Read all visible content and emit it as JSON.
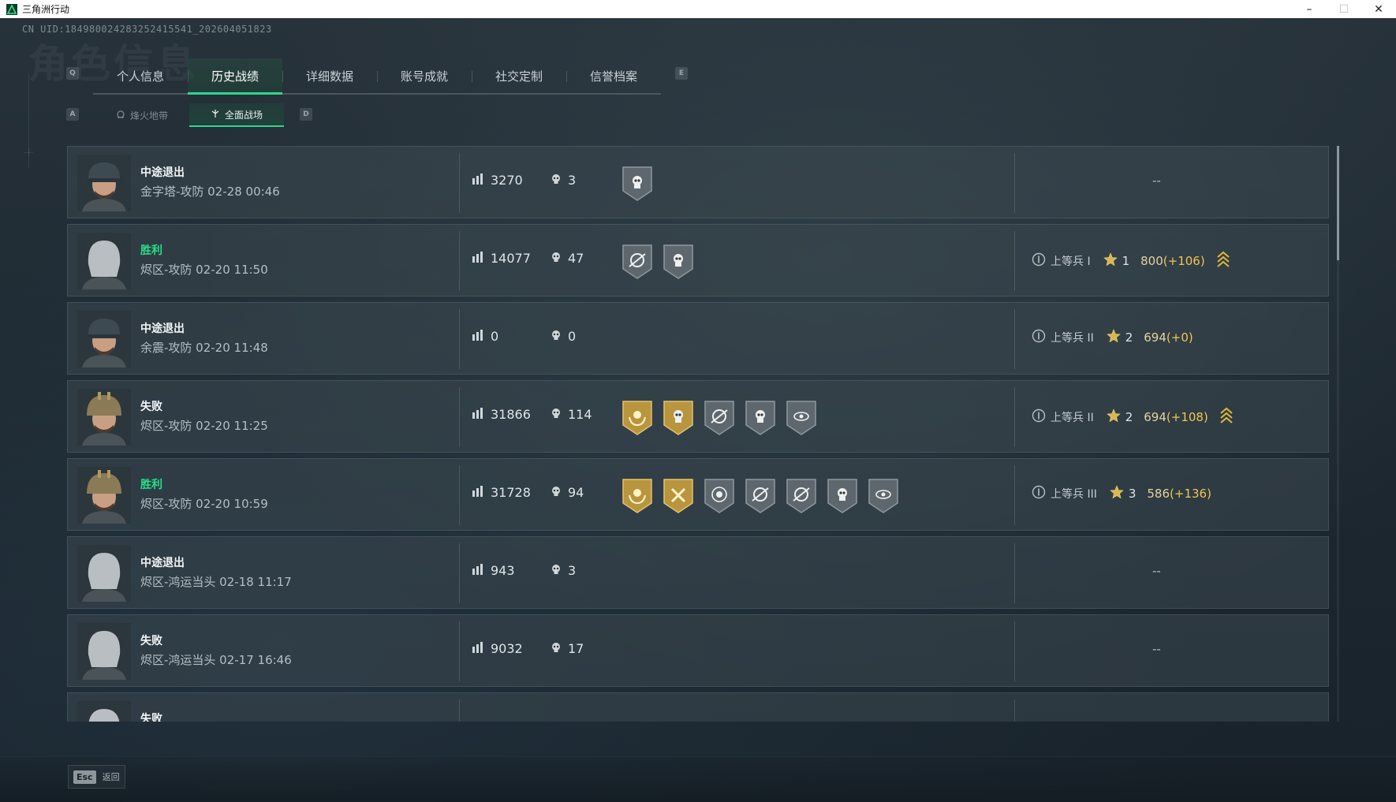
{
  "window": {
    "title": "三角洲行动",
    "minimize": "–",
    "maximize": "☐",
    "close": "✕"
  },
  "header": {
    "uid": "CN UID:18498002428325241554​1_202604051823",
    "bg_title": "角色信息"
  },
  "tabs": {
    "prev_key": "Q",
    "next_key": "E",
    "items": [
      {
        "label": "个人信息"
      },
      {
        "label": "历史战绩"
      },
      {
        "label": "详细数据"
      },
      {
        "label": "账号成就"
      },
      {
        "label": "社交定制"
      },
      {
        "label": "信誉档案"
      }
    ],
    "active_index": 1
  },
  "subtabs": {
    "prev_key": "A",
    "next_key": "D",
    "items": [
      {
        "label": "烽火地带",
        "icon": "hazard-icon"
      },
      {
        "label": "全面战场",
        "icon": "battlefield-icon"
      }
    ],
    "active_index": 1
  },
  "matches": [
    {
      "result": "中途退出",
      "result_type": "quit",
      "map": "金字塔-攻防 02-28 00:46",
      "score": "3270",
      "kills": "3",
      "badges": [
        "skull-gray"
      ],
      "rank": null,
      "dash": "--",
      "avatar": "male-cap"
    },
    {
      "result": "胜利",
      "result_type": "win",
      "map": "烬区-攻防 02-20 11:50",
      "score": "14077",
      "kills": "47",
      "badges": [
        "crosshair-gray",
        "skull-gray"
      ],
      "rank": {
        "name": "上等兵 I",
        "numeral": "I",
        "stars": "1",
        "points": "800",
        "delta": "(+106)",
        "arrow": true
      },
      "avatar": "female-mask"
    },
    {
      "result": "中途退出",
      "result_type": "quit",
      "map": "余震-攻防 02-20 11:48",
      "score": "0",
      "kills": "0",
      "badges": [],
      "rank": {
        "name": "上等兵 II",
        "numeral": "II",
        "stars": "2",
        "points": "694",
        "delta": "(+0)",
        "arrow": false
      },
      "avatar": "male-cap"
    },
    {
      "result": "失败",
      "result_type": "loss",
      "map": "烬区-攻防 02-20 11:25",
      "score": "31866",
      "kills": "114",
      "badges": [
        "wreath-gold",
        "skull-gold",
        "crosshair-gray",
        "skull-gray",
        "eye-gray"
      ],
      "rank": {
        "name": "上等兵 II",
        "numeral": "II",
        "stars": "2",
        "points": "694",
        "delta": "(+108)",
        "arrow": true
      },
      "avatar": "male-helmet"
    },
    {
      "result": "胜利",
      "result_type": "win",
      "map": "烬区-攻防 02-20 10:59",
      "score": "31728",
      "kills": "94",
      "badges": [
        "wreath-gold",
        "hammer-gold",
        "target-gray",
        "crosshair-gray",
        "crosshair-gray",
        "skull-gray",
        "eye-gray"
      ],
      "rank": {
        "name": "上等兵 III",
        "numeral": "III",
        "stars": "3",
        "points": "586",
        "delta": "(+136)",
        "arrow": false
      },
      "avatar": "male-helmet"
    },
    {
      "result": "中途退出",
      "result_type": "quit",
      "map": "烬区-鸿运当头 02-18 11:17",
      "score": "943",
      "kills": "3",
      "badges": [],
      "rank": null,
      "dash": "--",
      "avatar": "female-mask"
    },
    {
      "result": "失败",
      "result_type": "loss",
      "map": "烬区-鸿运当头 02-17 16:46",
      "score": "9032",
      "kills": "17",
      "badges": [],
      "rank": null,
      "dash": "--",
      "avatar": "female-mask"
    },
    {
      "result": "失败",
      "result_type": "loss",
      "map": "",
      "score": "",
      "kills": "",
      "badges": [],
      "rank": null,
      "dash": "",
      "avatar": "female-mask"
    }
  ],
  "footer": {
    "esc_key": "Esc",
    "esc_label": "返回"
  },
  "colors": {
    "accent": "#2fd68b",
    "win": "#27e08a",
    "delta": "#f0c552",
    "badge_gold": "#b8953e",
    "badge_gray": "#5d676d"
  }
}
